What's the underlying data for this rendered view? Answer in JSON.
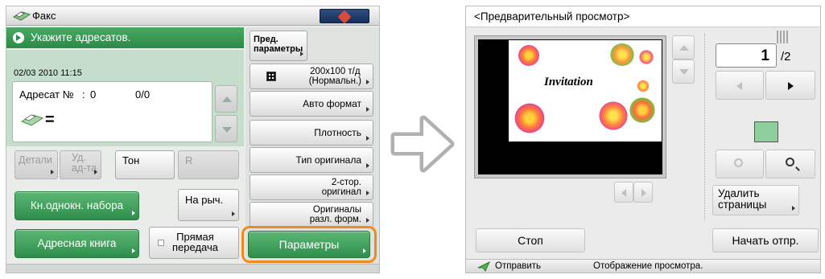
{
  "fax": {
    "title": "Факс",
    "instruction": "Укажите адресатов.",
    "datetime": "02/03 2010 11:15",
    "recipient_label": "Адресат №",
    "recipient_sep": ":",
    "recipient_no": "0",
    "recipient_count": "0/0",
    "eq_sign": "=",
    "btn_details": "Детали",
    "btn_delete_recipient": "Уд.\nад-та",
    "btn_tone": "Тон",
    "btn_r": "R",
    "btn_speed_dial": "Кн.однокн. набора",
    "btn_onhook": "На рыч.",
    "btn_address_book": "Адресная книга",
    "btn_direct_send": "Прямая\nпередача",
    "btn_prev_params": "Пред.\nпараметры",
    "resolution": "200x100 т/д\n(Нормальн.)",
    "auto_format": "Авто формат",
    "density": "Плотность",
    "orig_type": "Тип оригинала",
    "duplex": "2-стор.\nоригинал",
    "mixed_size": "Оригиналы\nразл. форм.",
    "params": "Параметры",
    "accent_orange": "#f08a1f"
  },
  "transition_arrow_icon": "arrow-right",
  "preview": {
    "title": "<Предварительный просмотр>",
    "invitation_text": "Invitation",
    "page_current": "1",
    "page_total": "/2",
    "delete_pages": "Удалить\nстраницы",
    "stop": "Стоп",
    "start_send": "Начать отпр.",
    "status_send": "Отправить",
    "status_text": "Отображение просмотра."
  }
}
